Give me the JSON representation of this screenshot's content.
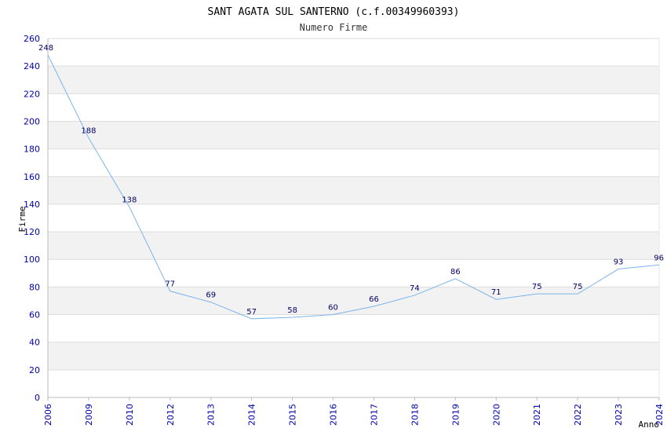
{
  "chart_data": {
    "type": "line",
    "title": "SANT AGATA SUL SANTERNO (c.f.00349960393)",
    "subtitle": "Numero Firme",
    "xlabel": "Anno",
    "ylabel": "Firme",
    "categories": [
      "2006",
      "2009",
      "2010",
      "2012",
      "2013",
      "2014",
      "2015",
      "2016",
      "2017",
      "2018",
      "2019",
      "2020",
      "2021",
      "2022",
      "2023",
      "2024"
    ],
    "series": [
      {
        "values": [
          248,
          188,
          138,
          77,
          69,
          57,
          58,
          60,
          66,
          74,
          86,
          71,
          75,
          75,
          93,
          96
        ]
      }
    ],
    "ylim": [
      0,
      260
    ],
    "y_ticks": [
      0,
      20,
      40,
      60,
      80,
      100,
      120,
      140,
      160,
      180,
      200,
      220,
      240,
      260
    ],
    "grid": true,
    "colors": {
      "line": "#7cb4ea",
      "tick_text": "#0000aa",
      "data_label": "#000066",
      "band": "#f2f2f2",
      "gridline": "#dddddd",
      "axis": "#bbbbbb"
    }
  }
}
